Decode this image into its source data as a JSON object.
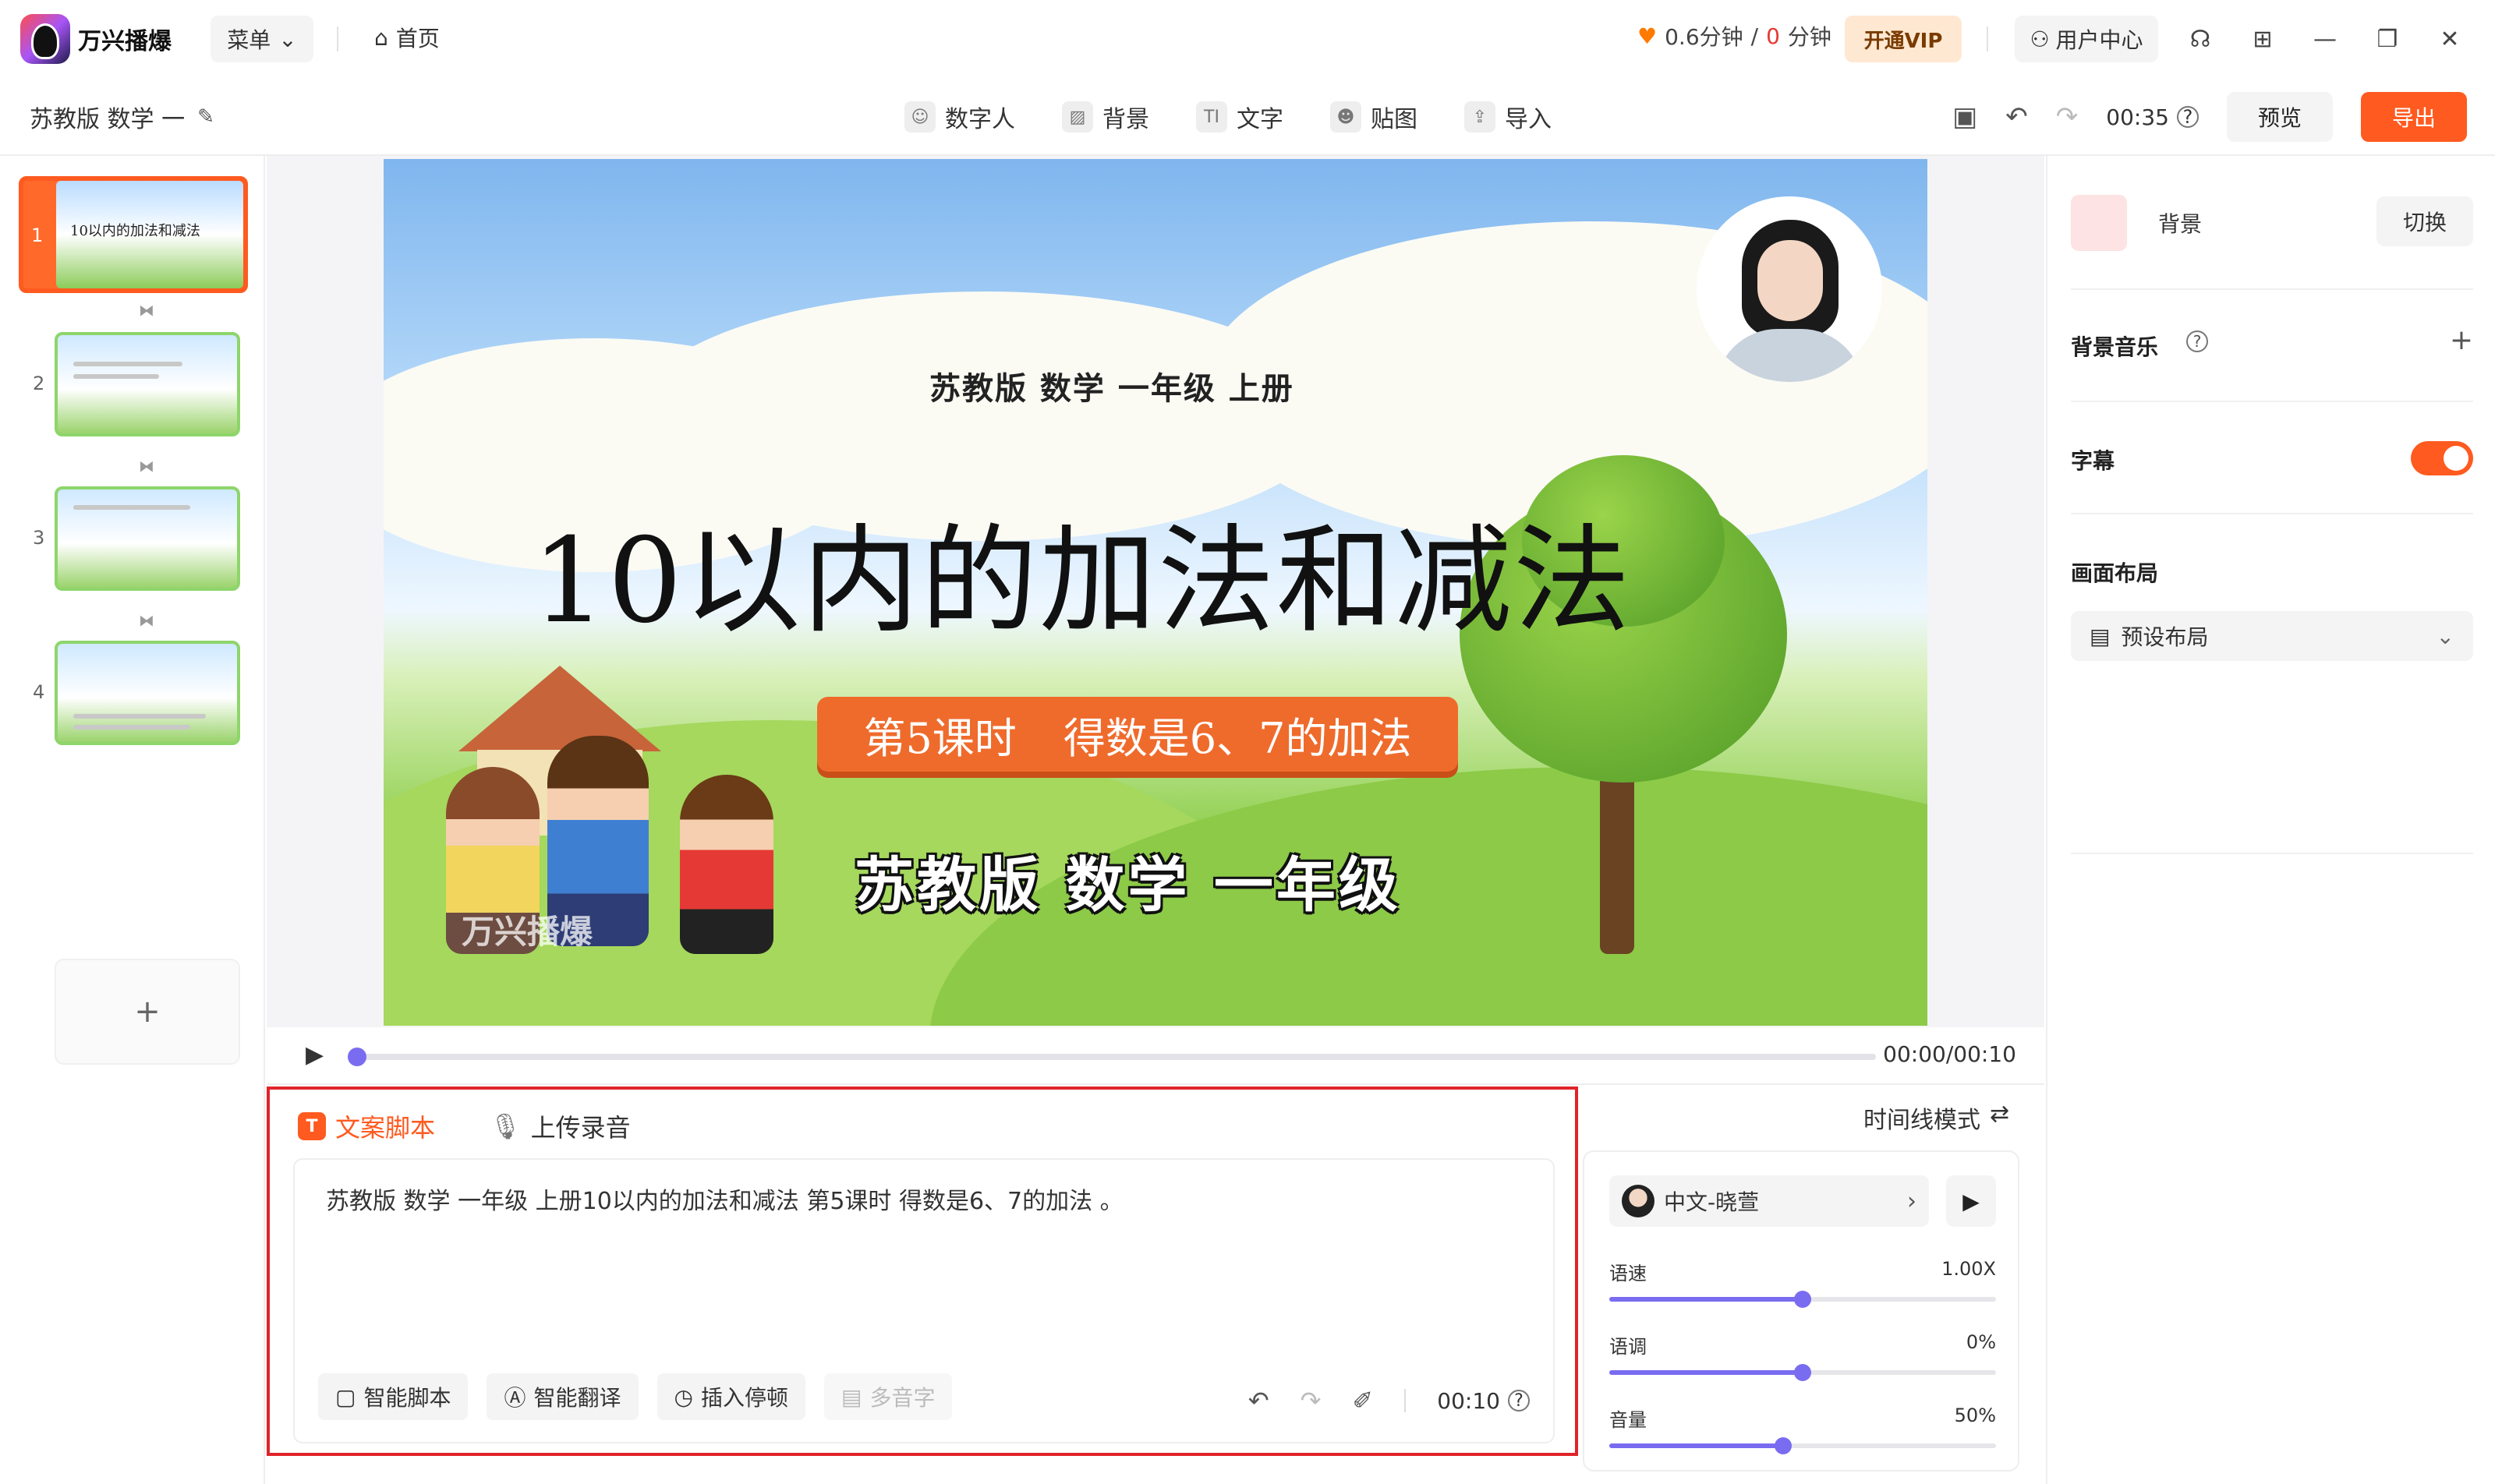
{
  "app": {
    "name": "万兴播爆",
    "menu_label": "菜单",
    "home_label": "首页"
  },
  "usage": {
    "used": "0.6分钟",
    "separator": "/",
    "remaining": "0",
    "unit": "分钟"
  },
  "vip_label": "开通VIP",
  "user_center_label": "用户中心",
  "project": {
    "title": "苏教版 数学 一"
  },
  "tools": [
    {
      "label": "数字人",
      "icon": "person-icon"
    },
    {
      "label": "背景",
      "icon": "background-icon"
    },
    {
      "label": "文字",
      "icon": "text-icon"
    },
    {
      "label": "贴图",
      "icon": "sticker-icon"
    },
    {
      "label": "导入",
      "icon": "import-icon"
    }
  ],
  "header": {
    "duration": "00:35",
    "preview_label": "预览",
    "export_label": "导出"
  },
  "slides": [
    {
      "num": "1",
      "title": "10以内的加法和减法"
    },
    {
      "num": "2"
    },
    {
      "num": "3"
    },
    {
      "num": "4"
    }
  ],
  "add_slide_label": "+",
  "slide": {
    "subtitle": "苏教版 数学 一年级 上册",
    "title": "10以内的加法和减法",
    "banner_left": "第5课时",
    "banner_right": "得数是6、7的加法",
    "caption": "苏教版 数学 一年级",
    "watermark": "万兴播爆"
  },
  "playback": {
    "time": "00:00/00:10",
    "progress": 0
  },
  "script": {
    "tab_script": "文案脚本",
    "tab_upload": "上传录音",
    "tab_script_badge": "T",
    "text": "苏教版  数学  一年级  上册10以内的加法和减法 第5课时  得数是6、7的加法 。",
    "buttons": [
      "智能脚本",
      "智能翻译",
      "插入停顿",
      "多音字"
    ],
    "duration": "00:10"
  },
  "timeline_mode_label": "时间线模式",
  "voice": {
    "name": "中文-晓萱",
    "speed_label": "语速",
    "speed_value": "1.00X",
    "speed_level": 0.5,
    "pitch_label": "语调",
    "pitch_value": "0%",
    "pitch_level": 0.5,
    "volume_label": "音量",
    "volume_value": "50%",
    "volume_level": 0.45
  },
  "right_panel": {
    "background_label": "背景",
    "switch_label": "切换",
    "bgm_label": "背景音乐",
    "subtitle_label": "字幕",
    "subtitle_on": true,
    "layout_label": "画面布局",
    "layout_value": "预设布局"
  },
  "colors": {
    "accent": "#ff5a1f",
    "slider": "#7a6cf0",
    "highlight_border": "#e0242a"
  }
}
